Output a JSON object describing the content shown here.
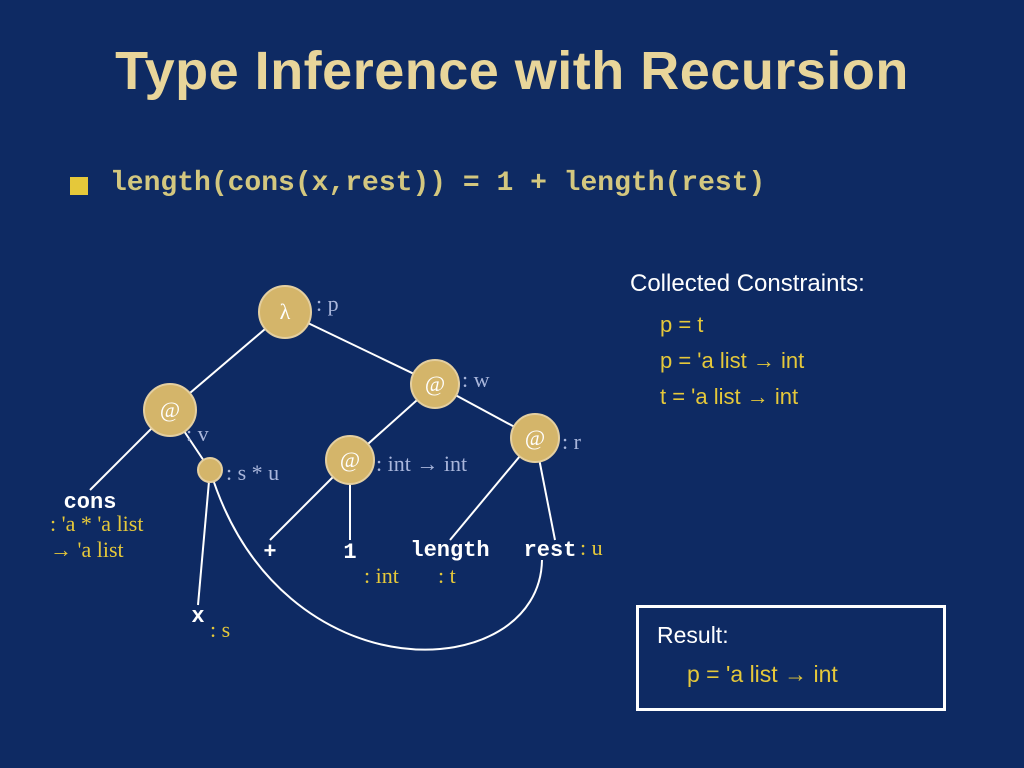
{
  "title": "Type Inference with Recursion",
  "bullet_code": "length(cons(x,rest)) = 1 + length(rest)",
  "tree": {
    "lambda_node": "λ",
    "app_node": "@",
    "leaves": {
      "cons": "cons",
      "x": "x",
      "plus": "+",
      "one": "1",
      "length": "length",
      "rest": "rest"
    },
    "annotations": {
      "p": ": p",
      "w": ": w",
      "v": ": v",
      "r": ": r",
      "s_times_u": ": s * u",
      "int_to_int": ": int → int",
      "cons_type_1": ": 'a * 'a list",
      "cons_type_2": "→ 'a list",
      "t": ": t",
      "int": ": int",
      "s": ": s",
      "u": ": u"
    }
  },
  "constraints": {
    "header": "Collected Constraints:",
    "items": [
      "p = t",
      "p = 'a list → int",
      "t = 'a list → int"
    ]
  },
  "result": {
    "label": "Result:",
    "value": "p = 'a list → int"
  }
}
